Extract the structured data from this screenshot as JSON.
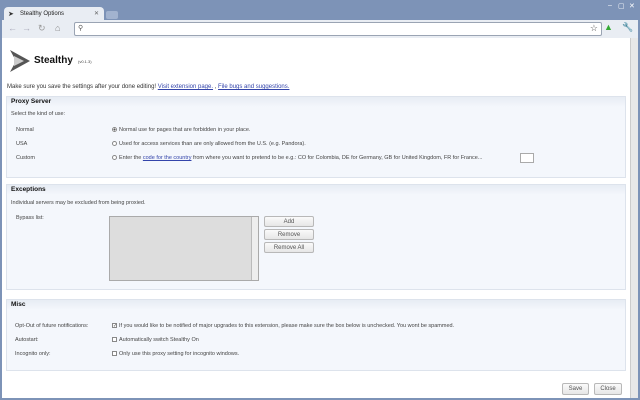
{
  "browser": {
    "tab_title": "Stealthy Options",
    "address": "",
    "minimize": "–",
    "maximize": "▢",
    "close": "✕"
  },
  "header": {
    "title": "Stealthy",
    "version": "(v0.1.3)",
    "intro": "Make sure you save the settings after your done editing!",
    "link1": "Visit extension page.",
    "sep": ",",
    "link2": "File bugs and suggestions."
  },
  "proxy": {
    "heading": "Proxy Server",
    "desc": "Select the kind of use:",
    "options": [
      {
        "label": "Normal",
        "text": "Normal use for pages that are forbidden in your place.",
        "selected": true
      },
      {
        "label": "USA",
        "text": "Used for access services than are only allowed from the U.S. (e.g. Pandora).",
        "selected": false
      },
      {
        "label": "Custom",
        "pre": "Enter the",
        "link": "code for the country",
        "text": "from where you want to pretend to be e.g.: CO for Colombia, DE for Germany, GB for United Kingdom, FR for France...",
        "selected": false,
        "value": ""
      }
    ]
  },
  "exceptions": {
    "heading": "Exceptions",
    "desc": "Individual servers may be excluded from being proxied.",
    "bypass_label": "Bypass list:",
    "add": "Add",
    "remove": "Remove",
    "remove_all": "Remove All"
  },
  "misc": {
    "heading": "Misc",
    "items": [
      {
        "label": "Opt-Out of future notifications:",
        "text": "If you would like to be notified of major upgrades to this extension, please make sure the box below is unchecked. You wont be spammed.",
        "checked": true
      },
      {
        "label": "Autostart:",
        "text": "Automatically switch Stealthy On",
        "checked": false
      },
      {
        "label": "Incognito only:",
        "text": "Only use this proxy setting for incognito windows.",
        "checked": false
      }
    ]
  },
  "footer": {
    "save": "Save",
    "close": "Close"
  }
}
